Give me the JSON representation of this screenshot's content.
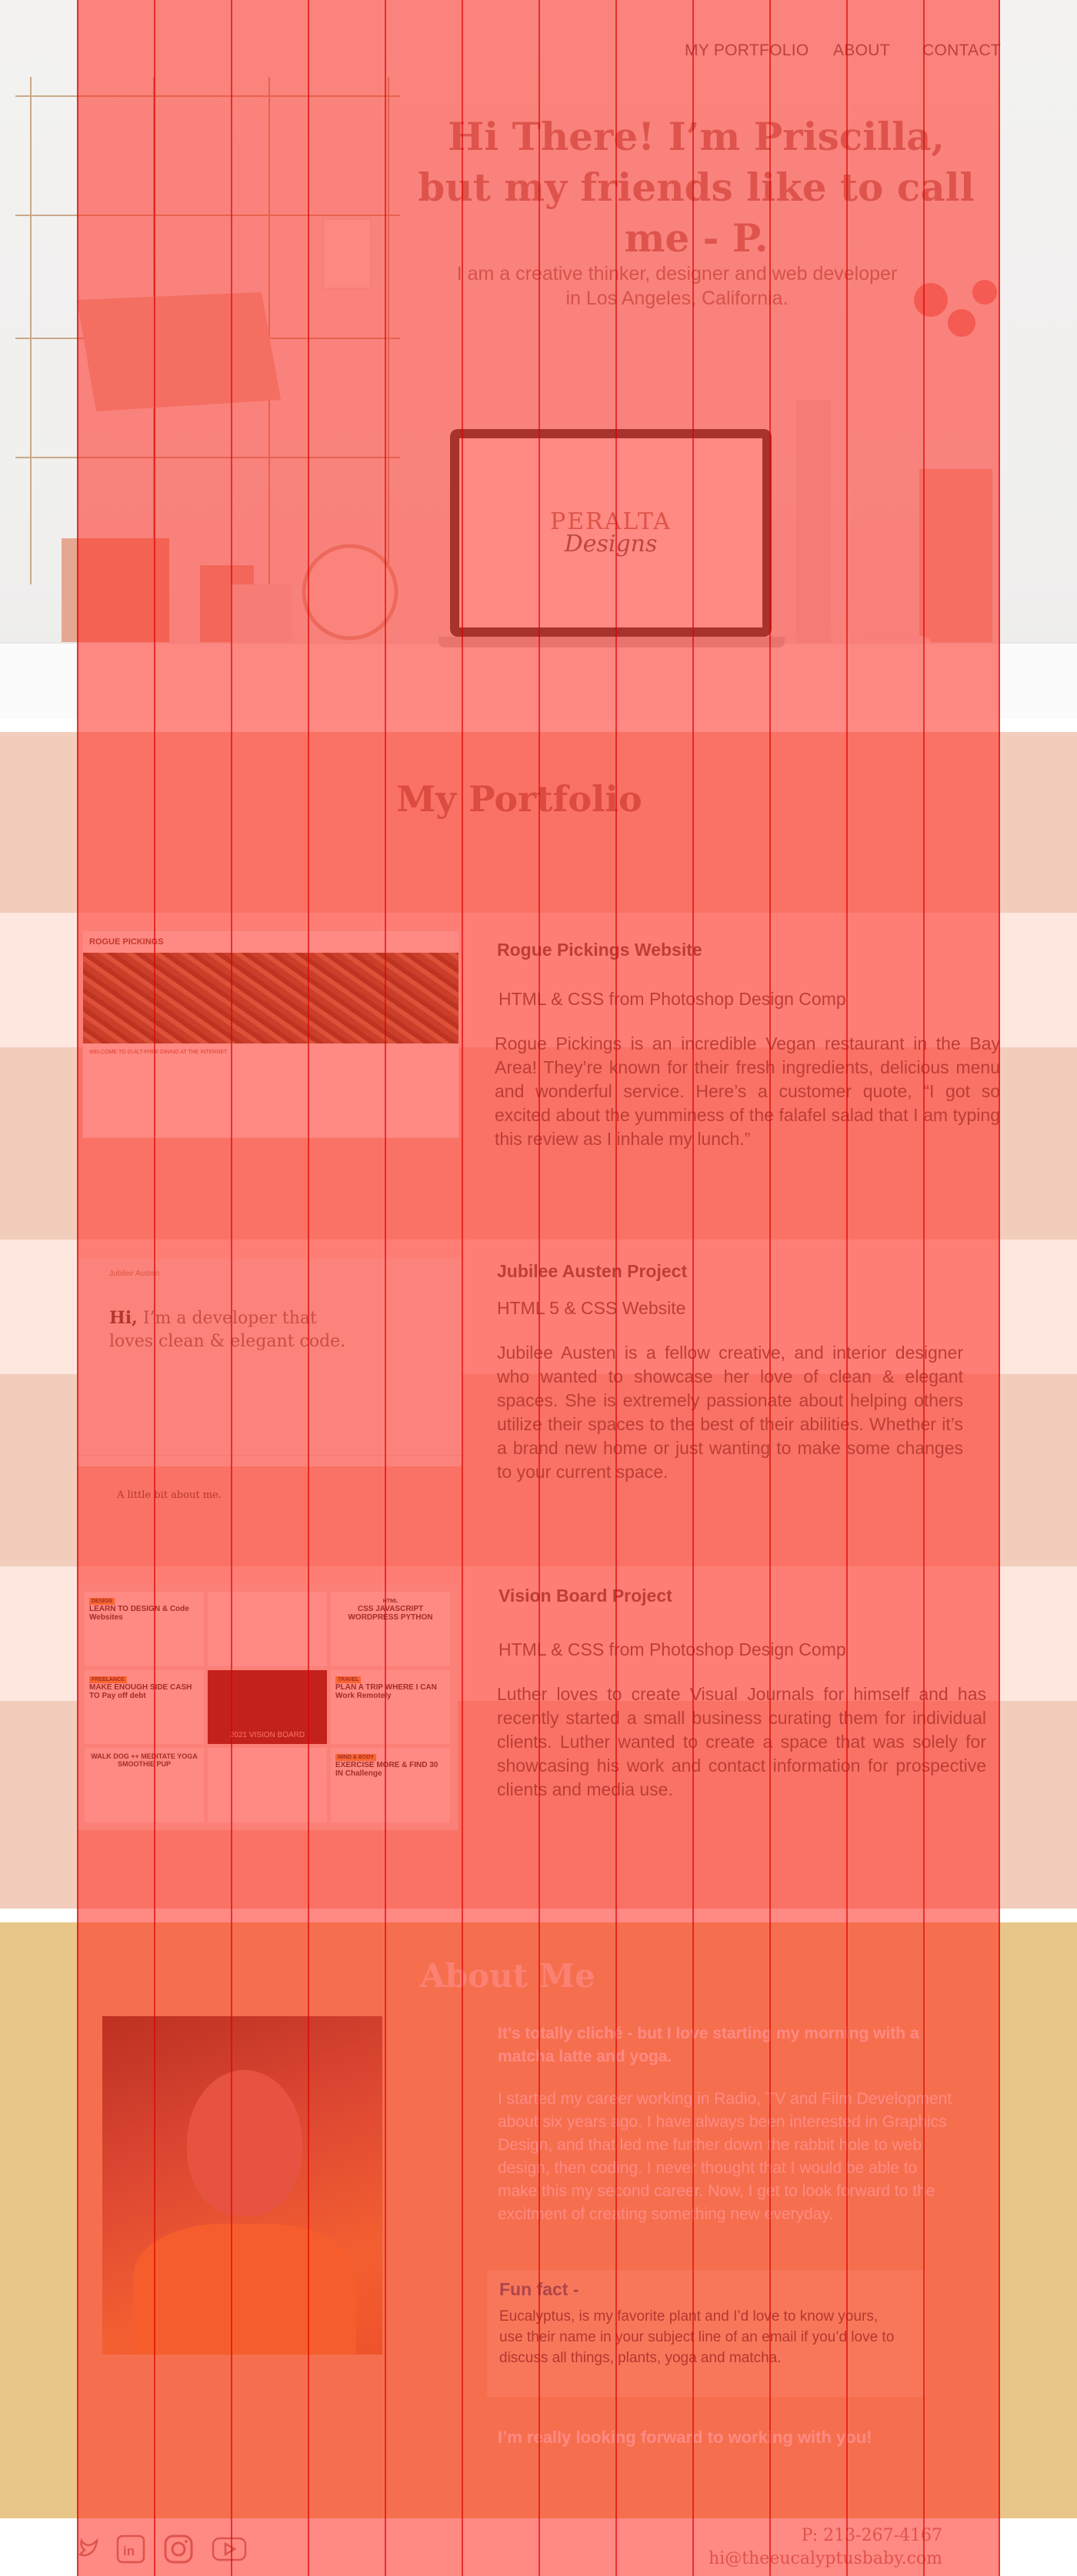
{
  "nav": {
    "items": [
      "MY PORTFOLIO",
      "ABOUT",
      "CONTACT"
    ]
  },
  "hero": {
    "title_line1": "Hi There! I’m Priscilla,",
    "title_line2": "but my friends like to call me - P.",
    "subtitle_line1": "I am a creative thinker, designer and web developer",
    "subtitle_line2": "in Los Angeles, California.",
    "laptop_logo_line1": "PERALTA",
    "laptop_logo_line2": "Designs"
  },
  "portfolio": {
    "heading": "My Portfolio",
    "projects": [
      {
        "title": "Rogue Pickings Website",
        "subtitle": "HTML & CSS from Photoshop Design Comp",
        "description": "Rogue Pickings is an incredible Vegan restaurant in the Bay Area! They’re known for their fresh ingredients, delicious menu and wonderful service. Here’s a customer quote, “I got so excited about the yumminess of the falafel salad that I am typing this review as I inhale my lunch.”",
        "thumb_brand": "ROGUE PICKINGS",
        "thumb_banner": "WELCOME TO GUILT-FREE DINING AT THE INTERNET"
      },
      {
        "title": "Jubilee Austen Project",
        "subtitle": "HTML 5 & CSS Website",
        "description": "Jubilee Austen is a fellow creative, and interior designer who wanted to showcase her love of clean & elegant spaces. She is extremely passionate about helping others utilize their spaces to the best of their abilities. Whether it’s a brand new home or just wanting to make some changes to your current space.",
        "thumb_brand": "Jubilee Austen",
        "thumb_hi": "Hi,",
        "thumb_headline": "I’m a developer that loves clean & elegant code.",
        "thumb_footer": "A little bit about me."
      },
      {
        "title": "Vision Board Project",
        "subtitle": "HTML & CSS from Photoshop Design Comp",
        "description": "Luther loves to create Visual Journals for himself and has recently started a small business curating them for individual clients. Luther wanted to create a space that was solely for showcasing his work and contact information for prospective clients and media use.",
        "tiles": [
          {
            "tag": "DESIGN",
            "text": "LEARN TO DESIGN & Code Websites"
          },
          {
            "tag": "",
            "text": ""
          },
          {
            "tag": "HTML",
            "text": "CSS JAVASCRIPT WORDPRESS PYTHON"
          },
          {
            "tag": "FREELANCE",
            "text": "MAKE ENOUGH SIDE CASH TO Pay off debt"
          },
          {
            "tag": "",
            "text": "2021 VISION BOARD"
          },
          {
            "tag": "TRAVEL",
            "text": "PLAN A TRIP WHERE I CAN Work Remotely"
          },
          {
            "tag": "",
            "text": "WALK DOG ++ MEDITATE YOGA SMOOTHIE PUP"
          },
          {
            "tag": "",
            "text": ""
          },
          {
            "tag": "MIND & BODY",
            "text": "EXERCISE MORE & FIND 30 IN Challenge"
          }
        ]
      }
    ]
  },
  "about": {
    "heading": "About Me",
    "lead": "It’s totally cliché - but I love starting my morning with a matcha latte and yoga.",
    "body": "I started my career working in Radio, TV and Film Development about six years ago. I have always been interested in Graphics Design, and that led me further down the rabbit hole to web design, then coding. I never thought that I would be able to make this my second career. Now, I get to look forward to the excitment of creating something new everyday.",
    "fun_title": "Fun fact -",
    "fun_text": "Eucalyptus, is my favorite plant and I’d love to know yours, use their name in your subject line of an email if you’d love to discuss all things, plants, yoga and matcha.",
    "closing": "I’m really looking forward to working with you!"
  },
  "footer": {
    "phone": "P: 213-267-4167",
    "email": "hi@theeucalyptusbaby.com",
    "social": [
      "twitter-icon",
      "linkedin-icon",
      "instagram-icon",
      "youtube-icon"
    ]
  },
  "colors": {
    "overlay": "#ff281e",
    "portfolio_bg": "#f3cdbc",
    "about_bg": "#e8c689",
    "accent": "#b58a86"
  }
}
